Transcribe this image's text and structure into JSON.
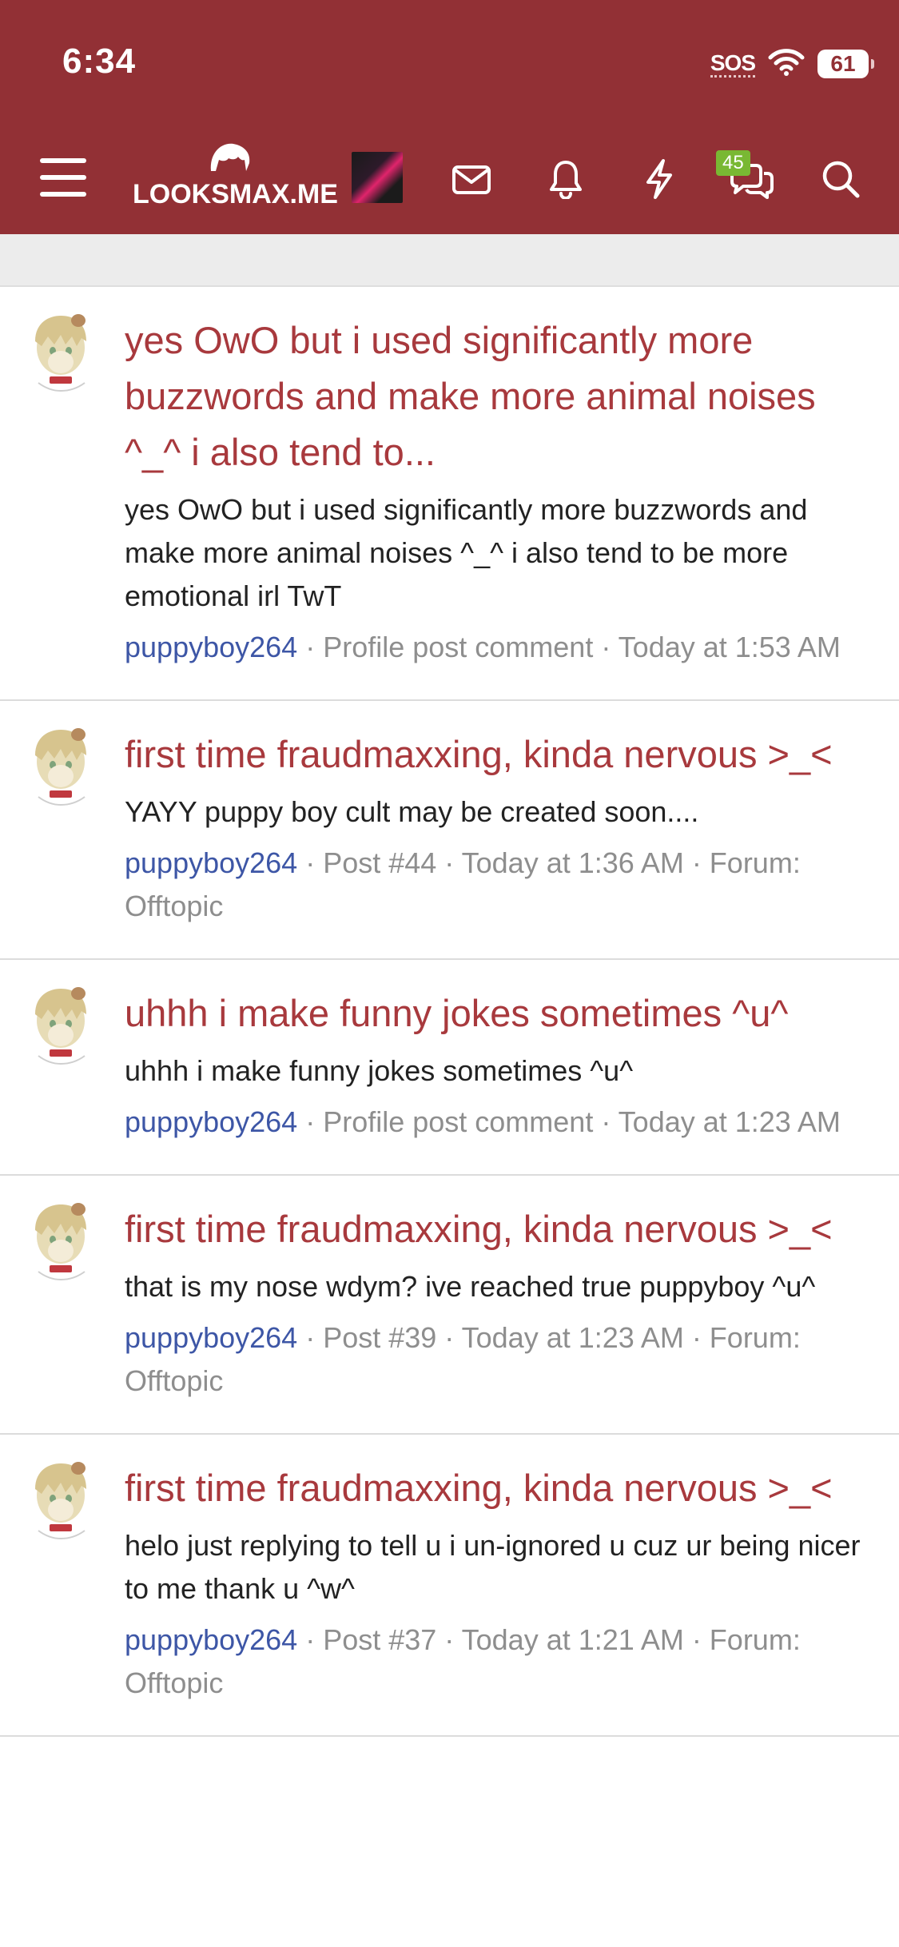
{
  "status_bar": {
    "time": "6:34",
    "sos_label": "SOS",
    "battery_level": "61"
  },
  "header": {
    "logo_text": "LOOKSMAX.ME",
    "conversations_badge": "45",
    "brand_color": "#923035"
  },
  "results": [
    {
      "title": "yes OwO but i used significantly more buzzwords and make more animal noises ^_^ i also tend to...",
      "snippet": "yes OwO but i used significantly more buzzwords and make more animal noises ^_^ i also tend to be more emotional irl TwT",
      "author": "puppyboy264",
      "meta": " · Profile post comment · Today at 1:53 AM"
    },
    {
      "title": "first time fraudmaxxing, kinda nervous >_<",
      "snippet": "YAYY puppy boy cult may be created soon....",
      "author": "puppyboy264",
      "meta": " · Post #44 · Today at 1:36 AM · Forum: Offtopic"
    },
    {
      "title": "uhhh i make funny jokes sometimes ^u^",
      "snippet": "uhhh i make funny jokes sometimes ^u^",
      "author": "puppyboy264",
      "meta": " · Profile post comment · Today at 1:23 AM"
    },
    {
      "title": "first time fraudmaxxing, kinda nervous >_<",
      "snippet": "that is my nose wdym? ive reached true puppyboy ^u^",
      "author": "puppyboy264",
      "meta": " · Post #39 · Today at 1:23 AM · Forum: Offtopic"
    },
    {
      "title": "first time fraudmaxxing, kinda nervous >_<",
      "snippet": "helo just replying to tell u i un-ignored u cuz ur being nicer to me thank u ^w^",
      "author": "puppyboy264",
      "meta": " · Post #37 · Today at 1:21 AM · Forum: Offtopic"
    }
  ]
}
